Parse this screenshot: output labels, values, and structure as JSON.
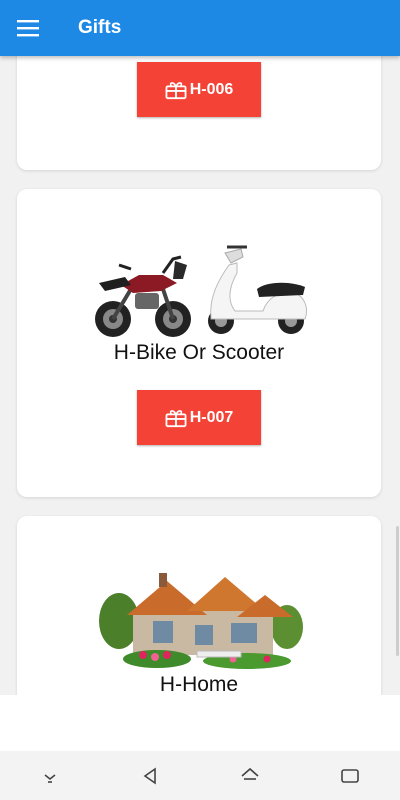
{
  "appbar": {
    "title": "Gifts",
    "menu_icon": "hamburger-menu-icon"
  },
  "colors": {
    "appbar": "#1e88e5",
    "code_button": "#f44336",
    "background": "#f1f1f1"
  },
  "gifts": [
    {
      "code": "H-006",
      "title": "",
      "icon": "gift-icon"
    },
    {
      "code": "H-007",
      "title": "H-Bike Or Scooter",
      "icon": "gift-icon",
      "image": "motorbike-and-scooter-image"
    },
    {
      "title": "H-Home",
      "image": "house-image"
    }
  ],
  "navbar": {
    "icons": [
      "collapse-icon",
      "back-icon",
      "home-icon",
      "recents-icon"
    ]
  }
}
